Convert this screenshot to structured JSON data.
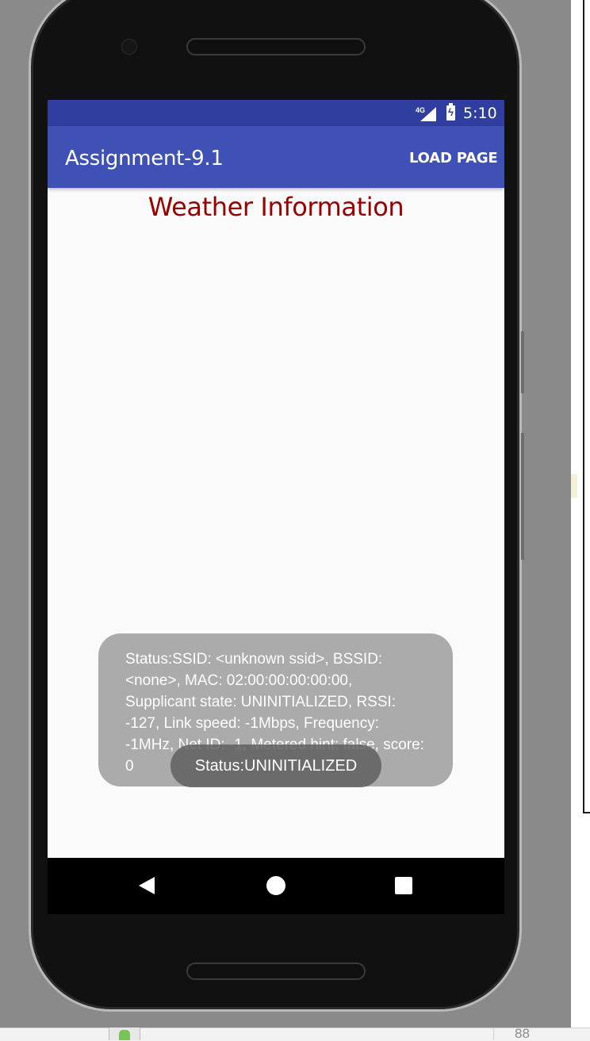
{
  "status_bar": {
    "network": "4G",
    "time": "5:10"
  },
  "app_bar": {
    "title": "Assignment-9.1",
    "action_label": "LOAD PAGE"
  },
  "main": {
    "heading": "Weather Information"
  },
  "toasts": {
    "wifi_info": "Status:SSID: <unknown ssid>, BSSID: <none>, MAC: 02:00:00:00:00:00, Supplicant state: UNINITIALIZED, RSSI: -127, Link speed: -1Mbps, Frequency: -1MHz, Net ID: -1, Metered hint: false, score: 0",
    "status": "Status:UNINITIALIZED"
  },
  "host": {
    "line_number": "88"
  },
  "colors": {
    "status_bar": "#303f9f",
    "app_bar": "#3f51b5",
    "heading": "#990000"
  }
}
